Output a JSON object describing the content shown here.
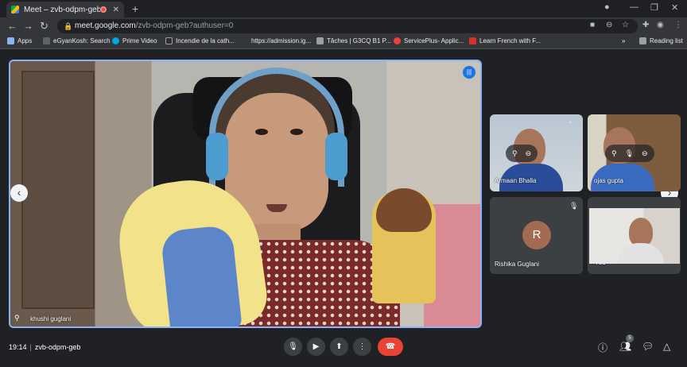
{
  "browser": {
    "tab_title": "Meet – zvb-odpm-geb",
    "new_tab": "+",
    "url_host": "meet.google.com",
    "url_path": "/zvb-odpm-geb?authuser=0",
    "bookmarks": [
      {
        "label": "Apps",
        "color": "#8ab4f8"
      },
      {
        "label": "eGyanKosh: Search",
        "color": "#5f6368"
      },
      {
        "label": "Prime Video",
        "color": "#00a8e1"
      },
      {
        "label": "Incendie de la cath...",
        "color": "#303030"
      },
      {
        "label": "https://admission.ig...",
        "color": "#202124"
      },
      {
        "label": "Tâches | G3CQ B1 P...",
        "color": "#9aa0a6"
      },
      {
        "label": "ServicePlus- Applic...",
        "color": "#ea4335"
      },
      {
        "label": "Learn French with F...",
        "color": "#d93025"
      }
    ],
    "more_bookmarks": "»",
    "reading_list": "Reading list"
  },
  "meeting": {
    "main_speaker": "khushi guglani",
    "participants": [
      {
        "name": "Armaan Bhalla"
      },
      {
        "name": "ojas gupta"
      },
      {
        "name": "Rishika Guglani",
        "initial": "R"
      },
      {
        "name": "You"
      }
    ],
    "time": "19:14",
    "code": "zvb-odpm-geb",
    "people_count": "5"
  },
  "colors": {
    "accent": "#8ab4f8",
    "end_call": "#ea4335",
    "control_bg": "#3c4043"
  }
}
